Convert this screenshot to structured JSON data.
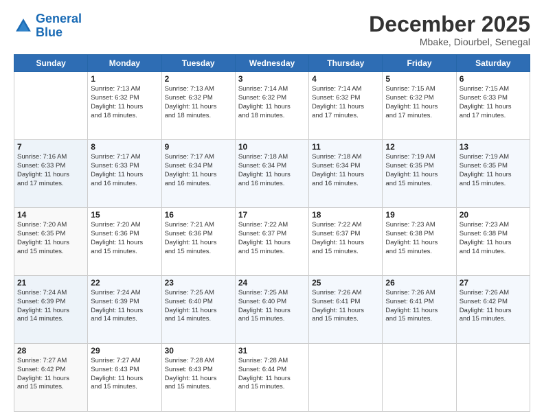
{
  "logo": {
    "line1": "General",
    "line2": "Blue"
  },
  "title": "December 2025",
  "location": "Mbake, Diourbel, Senegal",
  "days_header": [
    "Sunday",
    "Monday",
    "Tuesday",
    "Wednesday",
    "Thursday",
    "Friday",
    "Saturday"
  ],
  "weeks": [
    [
      {
        "num": "",
        "info": ""
      },
      {
        "num": "1",
        "info": "Sunrise: 7:13 AM\nSunset: 6:32 PM\nDaylight: 11 hours\nand 18 minutes."
      },
      {
        "num": "2",
        "info": "Sunrise: 7:13 AM\nSunset: 6:32 PM\nDaylight: 11 hours\nand 18 minutes."
      },
      {
        "num": "3",
        "info": "Sunrise: 7:14 AM\nSunset: 6:32 PM\nDaylight: 11 hours\nand 18 minutes."
      },
      {
        "num": "4",
        "info": "Sunrise: 7:14 AM\nSunset: 6:32 PM\nDaylight: 11 hours\nand 17 minutes."
      },
      {
        "num": "5",
        "info": "Sunrise: 7:15 AM\nSunset: 6:32 PM\nDaylight: 11 hours\nand 17 minutes."
      },
      {
        "num": "6",
        "info": "Sunrise: 7:15 AM\nSunset: 6:33 PM\nDaylight: 11 hours\nand 17 minutes."
      }
    ],
    [
      {
        "num": "7",
        "info": "Sunrise: 7:16 AM\nSunset: 6:33 PM\nDaylight: 11 hours\nand 17 minutes."
      },
      {
        "num": "8",
        "info": "Sunrise: 7:17 AM\nSunset: 6:33 PM\nDaylight: 11 hours\nand 16 minutes."
      },
      {
        "num": "9",
        "info": "Sunrise: 7:17 AM\nSunset: 6:34 PM\nDaylight: 11 hours\nand 16 minutes."
      },
      {
        "num": "10",
        "info": "Sunrise: 7:18 AM\nSunset: 6:34 PM\nDaylight: 11 hours\nand 16 minutes."
      },
      {
        "num": "11",
        "info": "Sunrise: 7:18 AM\nSunset: 6:34 PM\nDaylight: 11 hours\nand 16 minutes."
      },
      {
        "num": "12",
        "info": "Sunrise: 7:19 AM\nSunset: 6:35 PM\nDaylight: 11 hours\nand 15 minutes."
      },
      {
        "num": "13",
        "info": "Sunrise: 7:19 AM\nSunset: 6:35 PM\nDaylight: 11 hours\nand 15 minutes."
      }
    ],
    [
      {
        "num": "14",
        "info": "Sunrise: 7:20 AM\nSunset: 6:35 PM\nDaylight: 11 hours\nand 15 minutes."
      },
      {
        "num": "15",
        "info": "Sunrise: 7:20 AM\nSunset: 6:36 PM\nDaylight: 11 hours\nand 15 minutes."
      },
      {
        "num": "16",
        "info": "Sunrise: 7:21 AM\nSunset: 6:36 PM\nDaylight: 11 hours\nand 15 minutes."
      },
      {
        "num": "17",
        "info": "Sunrise: 7:22 AM\nSunset: 6:37 PM\nDaylight: 11 hours\nand 15 minutes."
      },
      {
        "num": "18",
        "info": "Sunrise: 7:22 AM\nSunset: 6:37 PM\nDaylight: 11 hours\nand 15 minutes."
      },
      {
        "num": "19",
        "info": "Sunrise: 7:23 AM\nSunset: 6:38 PM\nDaylight: 11 hours\nand 15 minutes."
      },
      {
        "num": "20",
        "info": "Sunrise: 7:23 AM\nSunset: 6:38 PM\nDaylight: 11 hours\nand 14 minutes."
      }
    ],
    [
      {
        "num": "21",
        "info": "Sunrise: 7:24 AM\nSunset: 6:39 PM\nDaylight: 11 hours\nand 14 minutes."
      },
      {
        "num": "22",
        "info": "Sunrise: 7:24 AM\nSunset: 6:39 PM\nDaylight: 11 hours\nand 14 minutes."
      },
      {
        "num": "23",
        "info": "Sunrise: 7:25 AM\nSunset: 6:40 PM\nDaylight: 11 hours\nand 14 minutes."
      },
      {
        "num": "24",
        "info": "Sunrise: 7:25 AM\nSunset: 6:40 PM\nDaylight: 11 hours\nand 15 minutes."
      },
      {
        "num": "25",
        "info": "Sunrise: 7:26 AM\nSunset: 6:41 PM\nDaylight: 11 hours\nand 15 minutes."
      },
      {
        "num": "26",
        "info": "Sunrise: 7:26 AM\nSunset: 6:41 PM\nDaylight: 11 hours\nand 15 minutes."
      },
      {
        "num": "27",
        "info": "Sunrise: 7:26 AM\nSunset: 6:42 PM\nDaylight: 11 hours\nand 15 minutes."
      }
    ],
    [
      {
        "num": "28",
        "info": "Sunrise: 7:27 AM\nSunset: 6:42 PM\nDaylight: 11 hours\nand 15 minutes."
      },
      {
        "num": "29",
        "info": "Sunrise: 7:27 AM\nSunset: 6:43 PM\nDaylight: 11 hours\nand 15 minutes."
      },
      {
        "num": "30",
        "info": "Sunrise: 7:28 AM\nSunset: 6:43 PM\nDaylight: 11 hours\nand 15 minutes."
      },
      {
        "num": "31",
        "info": "Sunrise: 7:28 AM\nSunset: 6:44 PM\nDaylight: 11 hours\nand 15 minutes."
      },
      {
        "num": "",
        "info": ""
      },
      {
        "num": "",
        "info": ""
      },
      {
        "num": "",
        "info": ""
      }
    ]
  ]
}
